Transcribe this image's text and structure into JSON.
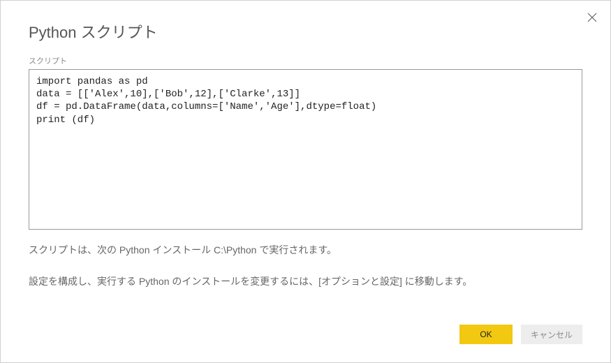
{
  "dialog": {
    "title": "Python スクリプト",
    "script_label": "スクリプト",
    "script_content": "import pandas as pd\ndata = [['Alex',10],['Bob',12],['Clarke',13]]\ndf = pd.DataFrame(data,columns=['Name','Age'],dtype=float)\nprint (df)",
    "info1": "スクリプトは、次の Python インストール C:\\Python で実行されます。",
    "info2": "設定を構成し、実行する Python のインストールを変更するには、[オプションと設定] に移動します。",
    "ok_label": "OK",
    "cancel_label": "キャンセル"
  }
}
